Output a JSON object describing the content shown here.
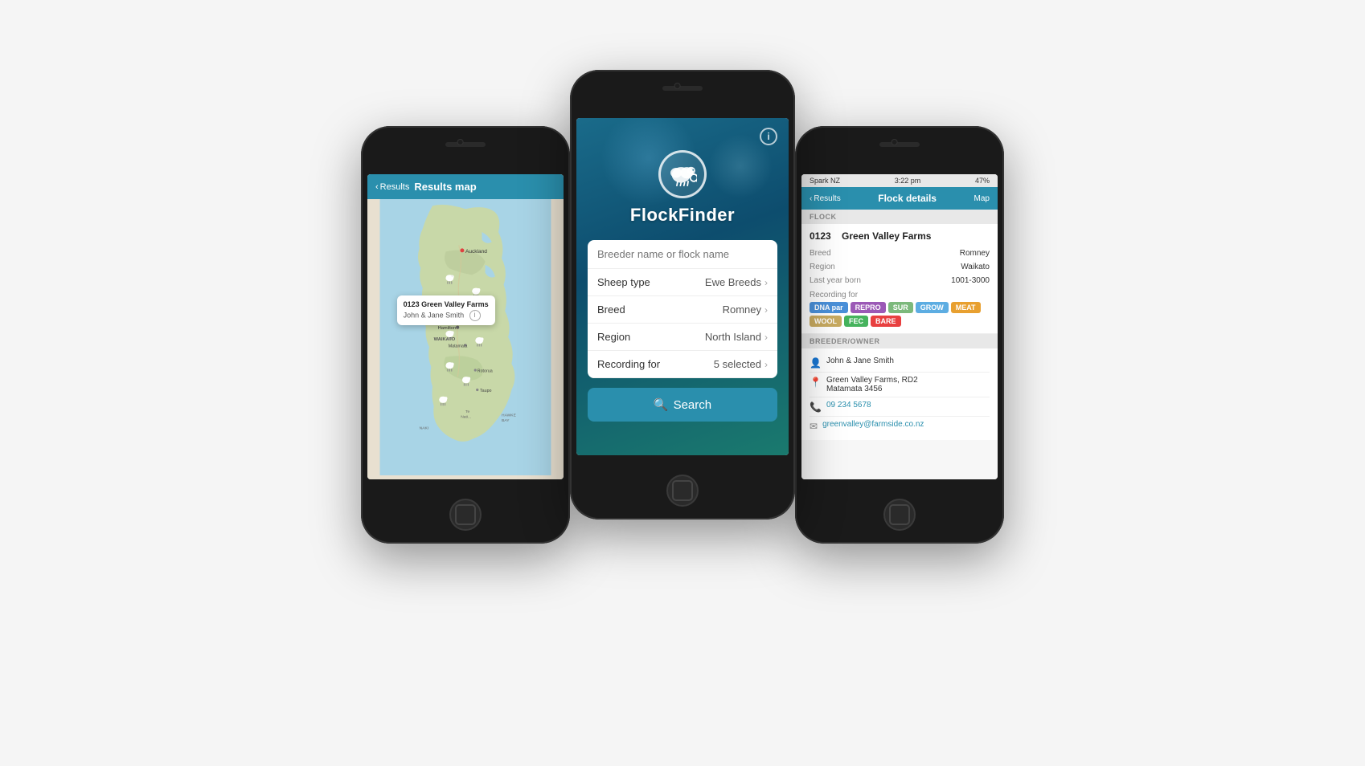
{
  "app": {
    "name": "FlockFinder"
  },
  "center_phone": {
    "title": "FlockFinder",
    "info_btn": "i",
    "search_placeholder": "Breeder name or flock name",
    "filters": [
      {
        "label": "Sheep type",
        "value": "Ewe Breeds"
      },
      {
        "label": "Breed",
        "value": "Romney"
      },
      {
        "label": "Region",
        "value": "North Island"
      },
      {
        "label": "Recording for",
        "value": "5 selected"
      }
    ],
    "search_btn": "Search"
  },
  "left_phone": {
    "nav_back": "Results",
    "nav_title": "Results map",
    "tooltip_title": "0123 Green Valley Farms",
    "tooltip_sub": "John & Jane Smith"
  },
  "right_phone": {
    "status_bar": {
      "carrier": "Spark NZ",
      "time": "3:22 pm",
      "battery": "47%"
    },
    "nav_back": "Results",
    "nav_title": "Flock details",
    "nav_map": "Map",
    "section_flock": "FLOCK",
    "flock_number": "0123",
    "flock_name": "Green Valley Farms",
    "breed_label": "Breed",
    "breed_val": "Romney",
    "region_label": "Region",
    "region_val": "Waikato",
    "last_year_label": "Last year born",
    "last_year_val": "1001-3000",
    "recording_for_label": "Recording for",
    "badges": [
      {
        "label": "DNA par",
        "class": "badge-dna"
      },
      {
        "label": "REPRO",
        "class": "badge-repro"
      },
      {
        "label": "SUR",
        "class": "badge-sur"
      },
      {
        "label": "GROW",
        "class": "badge-grow"
      },
      {
        "label": "MEAT",
        "class": "badge-meat"
      },
      {
        "label": "WOOL",
        "class": "badge-wool"
      },
      {
        "label": "FEC",
        "class": "badge-fec"
      },
      {
        "label": "BARE",
        "class": "badge-bare"
      }
    ],
    "section_breeder": "BREEDER/OWNER",
    "owner_name": "John & Jane Smith",
    "owner_address_line1": "Green Valley Farms, RD2",
    "owner_address_line2": "Matamata 3456",
    "owner_phone": "09 234 5678",
    "owner_email": "greenvalley@farmside.co.nz"
  }
}
